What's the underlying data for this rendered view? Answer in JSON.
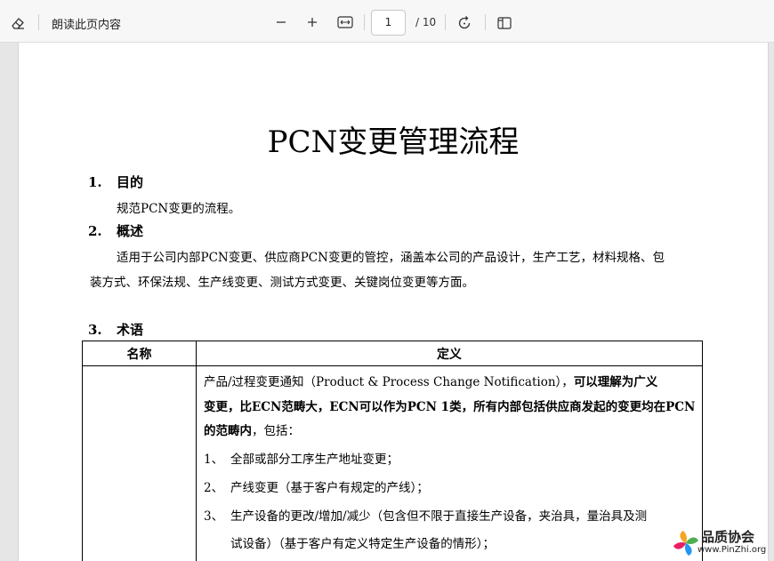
{
  "toolbar": {
    "read_aloud_label": "朗读此页内容",
    "current_page": "1",
    "page_total": "/ 10"
  },
  "document": {
    "title": "PCN变更管理流程",
    "section1": {
      "number": "1.",
      "heading": "目的",
      "text": "规范PCN变更的流程。"
    },
    "section2": {
      "number": "2.",
      "heading": "概述",
      "line1": "适用于公司内部PCN变更、供应商PCN变更的管控，涵盖本公司的产品设计，生产工艺，材料规格、包",
      "line2": "装方式、环保法规、生产线变更、测试方式变更、关键岗位变更等方面。"
    },
    "section3": {
      "number": "3.",
      "heading": "术语"
    },
    "table": {
      "col_name": "名称",
      "col_def": "定义",
      "def_line1_a": "产品/过程变更通知（Product & Process Change Notification），",
      "def_line1_b": "可以理解为广义",
      "def_line2": "变更，比ECN范畴大，ECN可以作为PCN 1类，所有内部包括供应商发起的变更均在PCN",
      "def_line3_a": "的范畴内",
      "def_line3_b": "，包括：",
      "item1_num": "1、",
      "item1": "全部或部分工序生产地址变更；",
      "item2_num": "2、",
      "item2": "产线变更（基于客户有规定的产线）；",
      "item3_num": "3、",
      "item3": "生产设备的更改/增加/减少（包含但不限于直接生产设备，夹治具，量治具及测",
      "item3_cont": "试设备）（基于客户有定义特定生产设备的情形）；"
    }
  },
  "watermark": {
    "name": "品质协会",
    "url": "www.PinZhi.org"
  }
}
